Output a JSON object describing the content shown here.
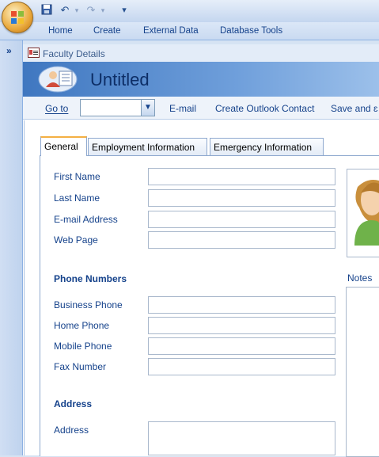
{
  "quick_access": {
    "save_icon": "save-icon",
    "undo_icon": "undo-icon",
    "redo_icon": "redo-icon",
    "customize_icon": "customize-icon"
  },
  "ribbon": {
    "tabs": [
      "Home",
      "Create",
      "External Data",
      "Database Tools"
    ]
  },
  "document_tab": {
    "label": "Faculty Details"
  },
  "header": {
    "title": "Untitled"
  },
  "toolbar": {
    "goto_label": "Go to",
    "goto_value": "",
    "email_label": "E-mail",
    "outlook_label": "Create Outlook Contact",
    "save_label": "Save and ɛ"
  },
  "subtabs": [
    "General",
    "Employment Information",
    "Emergency Information"
  ],
  "general": {
    "labels": {
      "first_name": "First Name",
      "last_name": "Last Name",
      "email": "E-mail Address",
      "web_page": "Web Page"
    },
    "values": {
      "first_name": "",
      "last_name": "",
      "email": "",
      "web_page": ""
    },
    "phone_section": "Phone Numbers",
    "phone_labels": {
      "business": "Business Phone",
      "home": "Home Phone",
      "mobile": "Mobile Phone",
      "fax": "Fax Number"
    },
    "phone_values": {
      "business": "",
      "home": "",
      "mobile": "",
      "fax": ""
    },
    "address_section": "Address",
    "address_label": "Address",
    "address_value": ""
  },
  "notes": {
    "label": "Notes",
    "value": ""
  },
  "colors": {
    "header_blue": "#3f77c0",
    "text_blue": "#15428b",
    "active_tab_accent": "#f4b043"
  }
}
